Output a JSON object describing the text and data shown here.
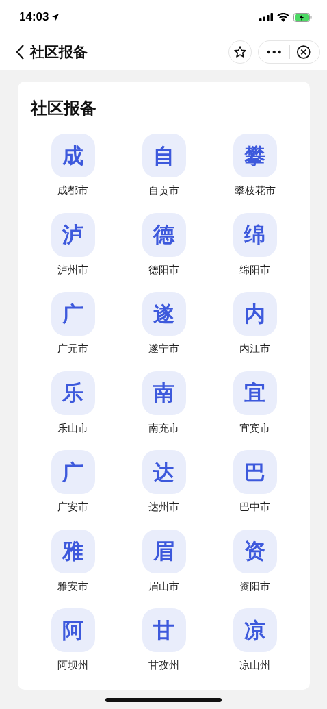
{
  "status_bar": {
    "time": "14:03"
  },
  "nav_bar": {
    "title": "社区报备"
  },
  "card": {
    "title": "社区报备",
    "cities": [
      {
        "icon": "成",
        "name": "成都市"
      },
      {
        "icon": "自",
        "name": "自贡市"
      },
      {
        "icon": "攀",
        "name": "攀枝花市"
      },
      {
        "icon": "泸",
        "name": "泸州市"
      },
      {
        "icon": "德",
        "name": "德阳市"
      },
      {
        "icon": "绵",
        "name": "绵阳市"
      },
      {
        "icon": "广",
        "name": "广元市"
      },
      {
        "icon": "遂",
        "name": "遂宁市"
      },
      {
        "icon": "内",
        "name": "内江市"
      },
      {
        "icon": "乐",
        "name": "乐山市"
      },
      {
        "icon": "南",
        "name": "南充市"
      },
      {
        "icon": "宜",
        "name": "宜宾市"
      },
      {
        "icon": "广",
        "name": "广安市"
      },
      {
        "icon": "达",
        "name": "达州市"
      },
      {
        "icon": "巴",
        "name": "巴中市"
      },
      {
        "icon": "雅",
        "name": "雅安市"
      },
      {
        "icon": "眉",
        "name": "眉山市"
      },
      {
        "icon": "资",
        "name": "资阳市"
      },
      {
        "icon": "阿",
        "name": "阿坝州"
      },
      {
        "icon": "甘",
        "name": "甘孜州"
      },
      {
        "icon": "凉",
        "name": "凉山州"
      }
    ]
  }
}
